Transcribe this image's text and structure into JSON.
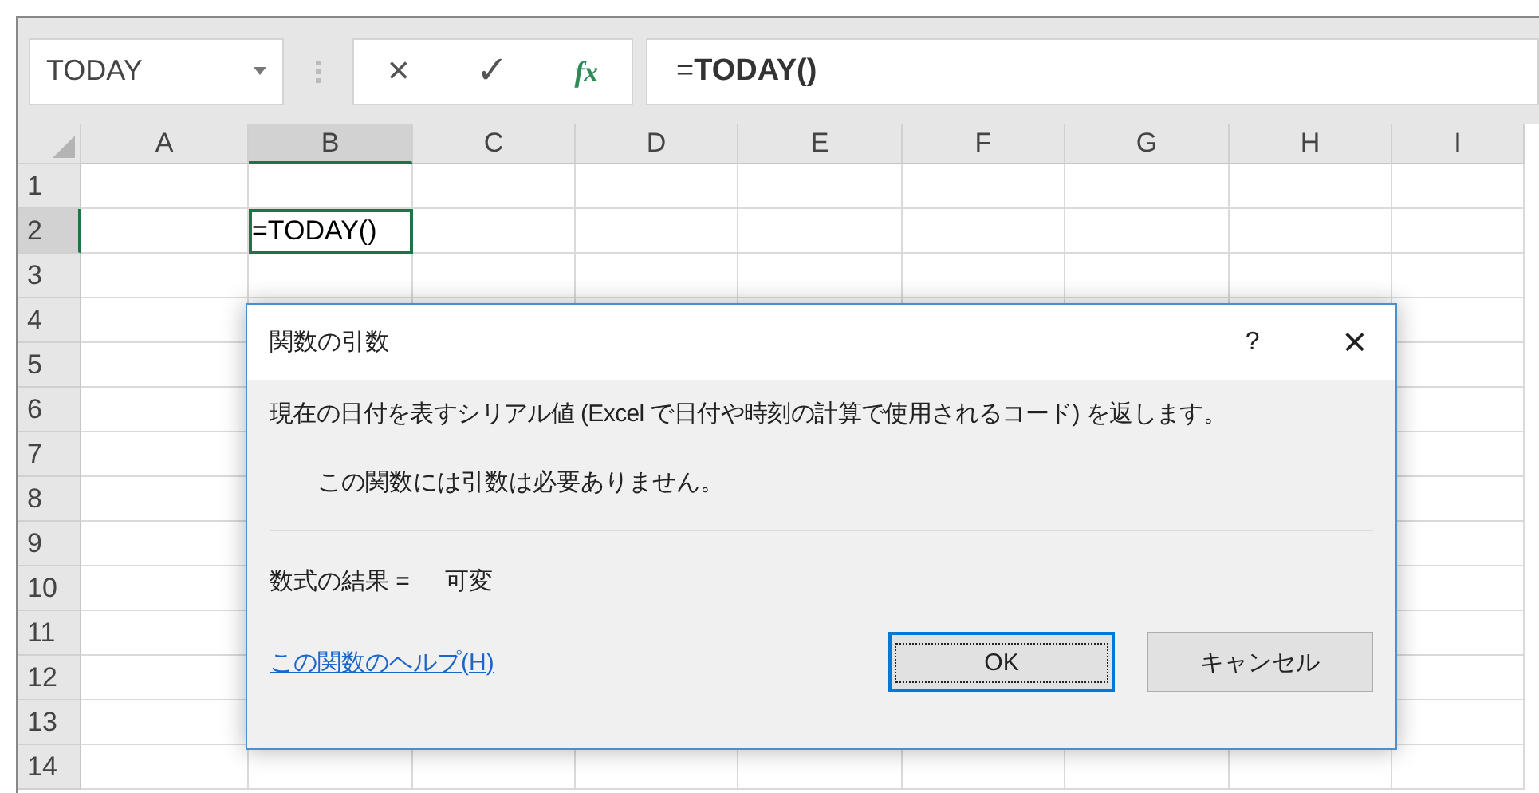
{
  "formula_bar": {
    "name_box": "TODAY",
    "cancel": "×",
    "enter": "✓",
    "function": "fx",
    "formula": "=**TODAY()**"
  },
  "columns": [
    {
      "label": "A",
      "selected": false
    },
    {
      "label": "B",
      "selected": true
    },
    {
      "label": "C",
      "selected": false
    },
    {
      "label": "D",
      "selected": false
    },
    {
      "label": "E",
      "selected": false
    },
    {
      "label": "F",
      "selected": false
    },
    {
      "label": "G",
      "selected": false
    },
    {
      "label": "H",
      "selected": false
    },
    {
      "label": "I",
      "selected": false
    }
  ],
  "rows": [
    {
      "label": "1",
      "selected": false
    },
    {
      "label": "2",
      "selected": true,
      "cells": [
        {
          "selected": false
        },
        {
          "value": "=TODAY()",
          "selected": true
        }
      ]
    },
    {
      "label": "3",
      "selected": false
    },
    {
      "label": "4",
      "selected": false
    },
    {
      "label": "5",
      "selected": false
    },
    {
      "label": "6",
      "selected": false
    },
    {
      "label": "7",
      "selected": false
    },
    {
      "label": "8",
      "selected": false
    },
    {
      "label": "9",
      "selected": false
    },
    {
      "label": "10",
      "selected": false
    },
    {
      "label": "11",
      "selected": false
    },
    {
      "label": "12",
      "selected": false
    },
    {
      "label": "13",
      "selected": false
    },
    {
      "label": "14",
      "selected": false
    }
  ],
  "dialog": {
    "title": "関数の引数",
    "help": "?",
    "close": "×",
    "description": "現在の日付を表すシリアル値 (Excel で日付や時刻の計算で使用されるコード) を返します。",
    "note": "この関数には引数は必要ありません。",
    "result_label": "数式の結果 =",
    "result_value": "可変",
    "help_link": "この関数のヘルプ(H)",
    "buttons": [
      {
        "label": "OK",
        "default": true
      },
      {
        "label": "キャンセル",
        "default": false
      }
    ]
  }
}
